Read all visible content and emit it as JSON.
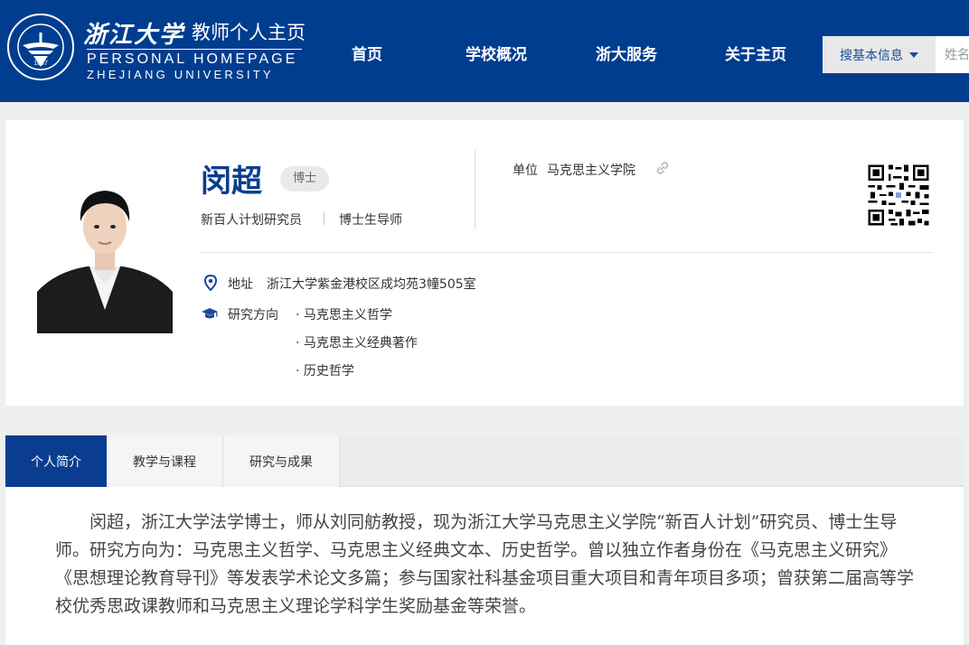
{
  "header": {
    "logo_cn": "浙江大学",
    "logo_sub": "教师个人主页",
    "logo_en1": "PERSONAL HOMEPAGE",
    "logo_en2": "ZHEJIANG UNIVERSITY",
    "seal_year": "1897",
    "seal_text": "ZHEJIANG UNIVERSITY",
    "nav": [
      "首页",
      "学校概况",
      "浙大服务",
      "关于主页"
    ],
    "search": {
      "select_label": "搜基本信息",
      "placeholder": "姓名"
    },
    "colors": {
      "brand": "#003d8f"
    }
  },
  "profile": {
    "name": "闵超",
    "degree": "博士",
    "titles": [
      "新百人计划研究员",
      "博士生导师"
    ],
    "unit_label": "单位",
    "unit_value": "马克思主义学院",
    "address_label": "地址",
    "address_value": "浙江大学紫金港校区成均苑3幢505室",
    "research_label": "研究方向",
    "research_items": [
      "· 马克思主义哲学",
      "· 马克思主义经典著作",
      "· 历史哲学"
    ],
    "icons": {
      "address": "map-pin-icon",
      "research": "graduation-cap-icon",
      "unit": "link-icon",
      "qr": "qr-code-icon"
    }
  },
  "tabs": [
    {
      "label": "个人简介",
      "active": true
    },
    {
      "label": "教学与课程",
      "active": false
    },
    {
      "label": "研究与成果",
      "active": false
    }
  ],
  "bio": "闵超，浙江大学法学博士，师从刘同舫教授，现为浙江大学马克思主义学院“新百人计划”研究员、博士生导师。研究方向为：马克思主义哲学、马克思主义经典文本、历史哲学。曾以独立作者身份在《马克思主义研究》《思想理论教育导刊》等发表学术论文多篇；参与国家社科基金项目重大项目和青年项目多项；曾获第二届高等学校优秀思政课教师和马克思主义理论学科学生奖励基金等荣誉。"
}
